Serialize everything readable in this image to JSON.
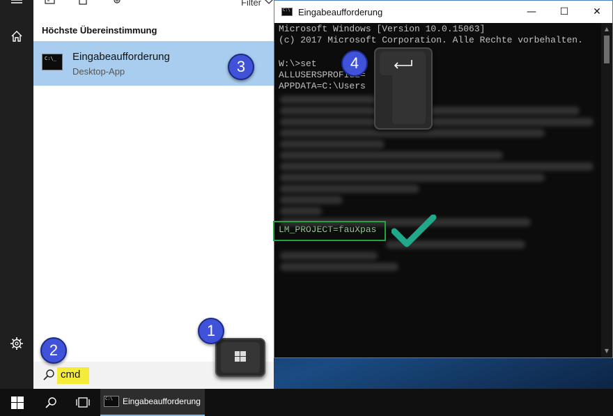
{
  "start_rail": {
    "menu_icon": "hamburger-icon",
    "home_icon": "home-icon",
    "settings_icon": "gear-icon"
  },
  "search_panel": {
    "filter_label": "Filter",
    "best_match_heading": "Höchste Übereinstimmung",
    "best_match": {
      "title": "Eingabeaufforderung",
      "subtitle": "Desktop-App",
      "icon_text": "C:\\_"
    },
    "search_query": "cmd"
  },
  "console_window": {
    "title": "Eingabeaufforderung",
    "icon_text": "C:\\",
    "controls": {
      "minimize": "—",
      "maximize": "☐",
      "close": "✕"
    },
    "lines": [
      "Microsoft Windows [Version 10.0.15063]",
      "(c) 2017 Microsoft Corporation. Alle Rechte vorbehalten.",
      "",
      "W:\\>set",
      "ALLUSERSPROFILE=",
      "APPDATA=C:\\Users",
      "LM_PROJECT=fauXpas"
    ]
  },
  "callouts": [
    "1",
    "2",
    "3",
    "4"
  ],
  "keycaps": {
    "windows_key": "windows-logo-icon",
    "enter_key": "enter-arrow-icon"
  },
  "taskbar": {
    "start_icon": "windows-logo-icon",
    "search_icon": "search-icon",
    "task_view_icon": "task-view-icon",
    "active_app_label": "Eingabeaufforderung",
    "active_app_icon_text": "C:\\"
  },
  "colors": {
    "selection": "#a8cdee",
    "search_highlight": "#f5ec3a",
    "callout": "#3f52d8",
    "check": "#1fa88a",
    "highlight_box": "#25a244"
  }
}
